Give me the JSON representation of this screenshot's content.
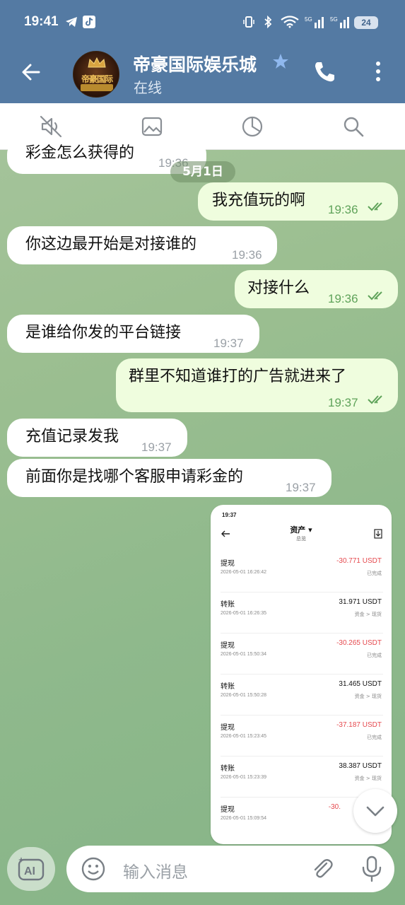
{
  "status_bar": {
    "time": "19:41",
    "battery": "24"
  },
  "header": {
    "title": "帝豪国际娱乐城",
    "subtitle": "在线"
  },
  "avatar": {
    "text": "帝豪国际"
  },
  "date_separator": "5月1日",
  "messages": [
    {
      "dir": "in",
      "text": "彩金怎么获得的",
      "time": "19:36"
    },
    {
      "dir": "out",
      "text": "我充值玩的啊",
      "time": "19:36"
    },
    {
      "dir": "in",
      "text": "你这边最开始是对接谁的",
      "time": "19:36"
    },
    {
      "dir": "out",
      "text": "对接什么",
      "time": "19:36"
    },
    {
      "dir": "in",
      "text": "是谁给你发的平台链接",
      "time": "19:37"
    },
    {
      "dir": "out",
      "text": "群里不知道谁打的广告就进来了",
      "time": "19:37"
    },
    {
      "dir": "in",
      "text": "充值记录发我",
      "time": "19:37"
    },
    {
      "dir": "in",
      "text": "前面你是找哪个客服申请彩金的",
      "time": "19:37"
    }
  ],
  "screenshot": {
    "status_time": "19:37",
    "title": "资产 ▾",
    "subtitle": "总览",
    "rows": [
      {
        "type": "提现",
        "time": "2026-05-01 16:26:42",
        "amount": "-30.771 USDT",
        "note": "已完成",
        "negative": true
      },
      {
        "type": "转账",
        "time": "2026-05-01 16:26:35",
        "amount": "31.971 USDT",
        "note": "资金 > 现货",
        "negative": false
      },
      {
        "type": "提现",
        "time": "2026-05-01 15:50:34",
        "amount": "-30.265 USDT",
        "note": "已完成",
        "negative": true
      },
      {
        "type": "转账",
        "time": "2026-05-01 15:50:28",
        "amount": "31.465 USDT",
        "note": "资金 > 现货",
        "negative": false
      },
      {
        "type": "提现",
        "time": "2026-05-01 15:23:45",
        "amount": "-37.187 USDT",
        "note": "已完成",
        "negative": true
      },
      {
        "type": "转账",
        "time": "2026-05-01 15:23:39",
        "amount": "38.387 USDT",
        "note": "资金 > 现货",
        "negative": false
      },
      {
        "type": "提现",
        "time": "2026-05-01 15:09:54",
        "amount": "-30.",
        "note": "",
        "negative": true
      }
    ]
  },
  "input": {
    "placeholder": "输入消息"
  },
  "colors": {
    "header": "#547aa3",
    "outgoing_bubble": "#effdde",
    "incoming_bubble": "#ffffff",
    "check": "#5fa35a"
  }
}
